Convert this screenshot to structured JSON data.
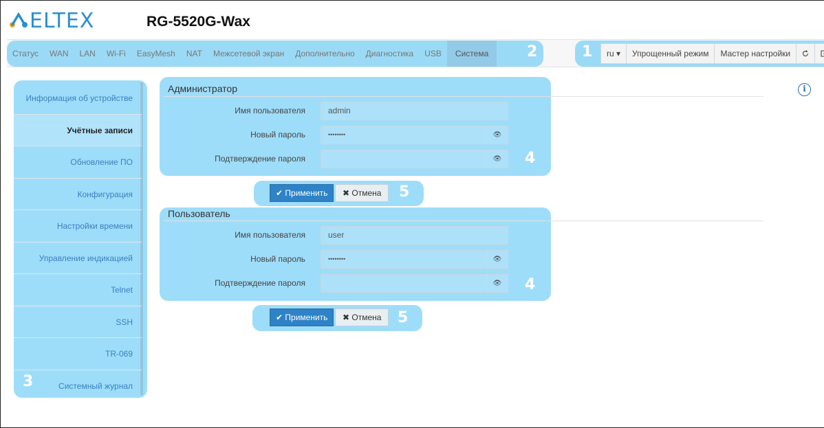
{
  "header": {
    "brand": "ELTEX",
    "model": "RG-5520G-Wax"
  },
  "nav": {
    "items": [
      "Статус",
      "WAN",
      "LAN",
      "Wi-Fi",
      "EasyMesh",
      "NAT",
      "Межсетевой экран",
      "Дополнительно",
      "Диагностика",
      "USB",
      "Система"
    ],
    "active": "Система"
  },
  "tools": {
    "lang": "ru ▾",
    "simple_mode": "Упрощенный режим",
    "wizard": "Мастер настройки",
    "refresh_icon": "refresh-icon",
    "logout_icon": "logout-icon"
  },
  "badges": {
    "tools": "1",
    "nav": "2",
    "sidebar": "3",
    "form1": "4",
    "buttons1": "5",
    "form2": "4",
    "buttons2": "5"
  },
  "sidebar": {
    "items": [
      "Информация об устройстве",
      "Учётные записи",
      "Обновление ПО",
      "Конфигурация",
      "Настройки времени",
      "Управление индикацией",
      "Telnet",
      "SSH",
      "TR-069",
      "Системный журнал"
    ],
    "active": "Учётные записи"
  },
  "admin": {
    "title": "Администратор",
    "username_label": "Имя пользователя",
    "username_value": "admin",
    "password_label": "Новый пароль",
    "password_value": "••••••••",
    "confirm_label": "Подтверждение пароля",
    "confirm_value": ""
  },
  "user": {
    "title": "Пользователь",
    "username_label": "Имя пользователя",
    "username_value": "user",
    "password_label": "Новый пароль",
    "password_value": "••••••••",
    "confirm_label": "Подтверждение пароля",
    "confirm_value": ""
  },
  "buttons": {
    "apply": "✔ Применить",
    "cancel": "✖ Отмена"
  },
  "colors": {
    "brand": "#2a8fce",
    "highlight": "#62c8f5",
    "primary_button": "#2e82c6"
  }
}
